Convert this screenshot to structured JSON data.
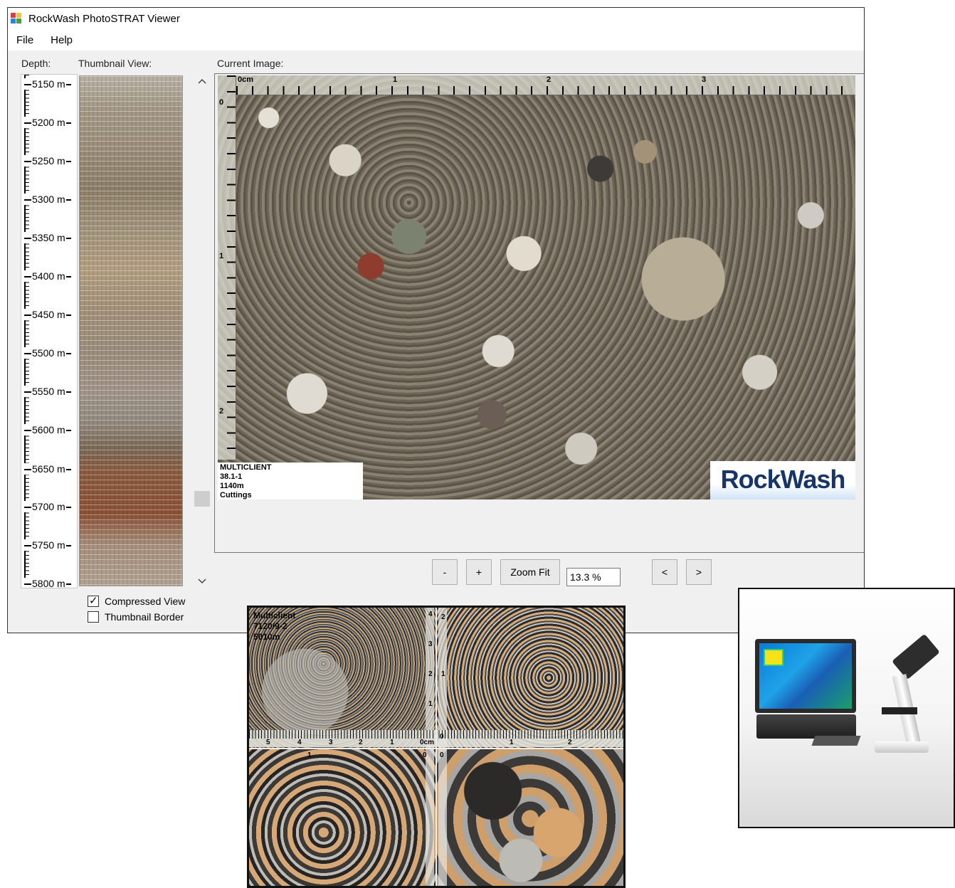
{
  "window": {
    "title": "RockWash PhotoSTRAT Viewer"
  },
  "menu": {
    "items": [
      "File",
      "Help"
    ]
  },
  "labels": {
    "depth": "Depth:",
    "thumbnail_view": "Thumbnail View:",
    "current_image": "Current Image:"
  },
  "depth_ruler": {
    "labels": [
      "5150 m",
      "5200 m",
      "5250 m",
      "5300 m",
      "5350 m",
      "5400 m",
      "5450 m",
      "5500 m",
      "5550 m",
      "5600 m",
      "5650 m",
      "5700 m",
      "5750 m",
      "5800 m"
    ]
  },
  "scrollbar": {
    "up_glyph": "^",
    "down_glyph": "v"
  },
  "options": {
    "compressed_view": {
      "label": "Compressed View",
      "checked": true
    },
    "thumbnail_border": {
      "label": "Thumbnail Border",
      "checked": false
    }
  },
  "current_image": {
    "scale_top_labels": [
      "0cm",
      "1",
      "2",
      "3"
    ],
    "scale_left_labels": [
      "0",
      "1",
      "2"
    ],
    "info_lines": [
      "MULTICLIENT",
      "38.1-1",
      "1140m",
      "Cuttings"
    ],
    "logo_text": "RockWash"
  },
  "toolbar": {
    "zoom_out": "-",
    "zoom_in": "+",
    "zoom_fit": "Zoom Fit",
    "zoom_value": "13.3 %",
    "prev": "<",
    "next": ">"
  },
  "composite_image": {
    "info_lines": [
      "Multiclient",
      "7120/9-2",
      "5010m"
    ],
    "h_scale_labels": [
      "5",
      "4",
      "3",
      "2",
      "1",
      "0cm",
      "0",
      "1",
      "2"
    ],
    "v_scale_labels": [
      "4",
      "3",
      "2",
      "1"
    ],
    "q2_v_labels": [
      "2",
      "1"
    ],
    "q3_labels": [
      "0",
      "0"
    ],
    "q3_top_label": "1"
  },
  "colors": {
    "window_bg": "#f0f0f0",
    "logo_text": "#17356b",
    "button_bg": "#e8e8e8"
  }
}
